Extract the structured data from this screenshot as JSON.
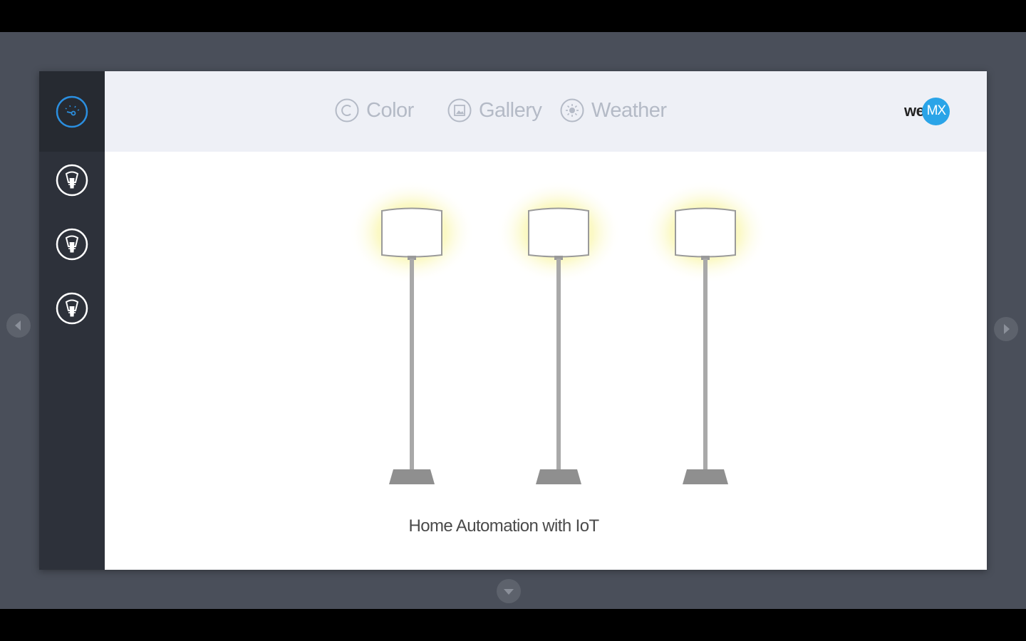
{
  "sidebar": {
    "items": [
      {
        "name": "dashboard",
        "icon": "dial-icon",
        "active": true
      },
      {
        "name": "light-1",
        "icon": "bulb-icon",
        "active": false
      },
      {
        "name": "light-2",
        "icon": "bulb-icon",
        "active": false
      },
      {
        "name": "light-3",
        "icon": "bulb-icon",
        "active": false
      }
    ]
  },
  "tabs": [
    {
      "label": "Color",
      "icon": "copyright-circle-icon"
    },
    {
      "label": "Gallery",
      "icon": "image-icon"
    },
    {
      "label": "Weather",
      "icon": "sun-icon"
    }
  ],
  "brand": {
    "we": "we",
    "mx": "MX"
  },
  "lamps": [
    {
      "name": "lamp-1",
      "on": true
    },
    {
      "name": "lamp-2",
      "on": true
    },
    {
      "name": "lamp-3",
      "on": true
    }
  ],
  "caption": "Home Automation with IoT",
  "colors": {
    "accent": "#2aa4e8",
    "glow": "#f6f27a",
    "sidebar": "#2d313a",
    "stage": "#4a4f5a",
    "topbar": "#eef0f6"
  }
}
